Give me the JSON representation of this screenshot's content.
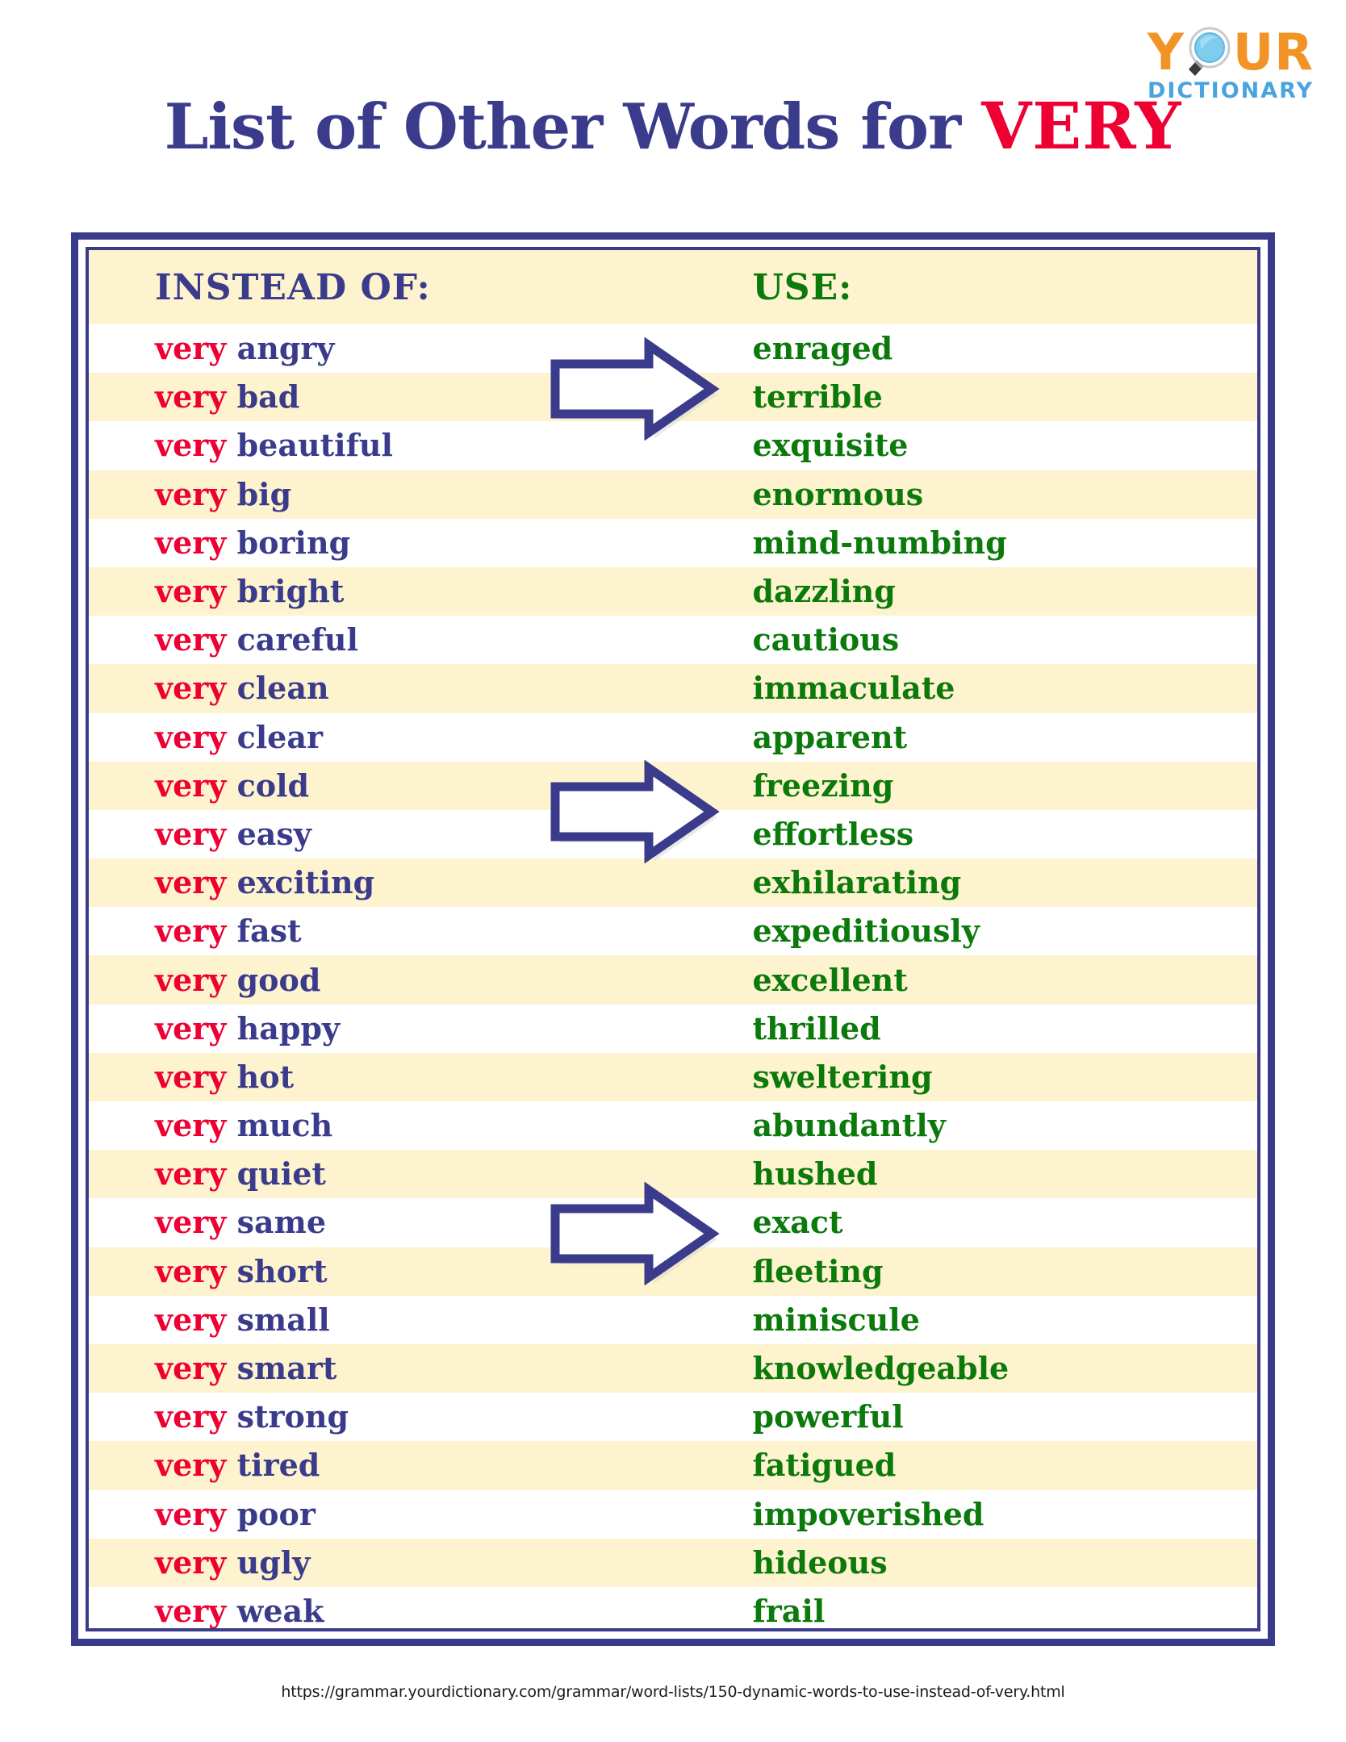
{
  "logo": {
    "wordmark_pre": "Y",
    "wordmark_post": "UR",
    "subtitle": "DICTIONARY",
    "magnifier_icon": "magnifying-glass-icon",
    "orange": "#F29325",
    "blue": "#4BA3DE"
  },
  "title": {
    "main": "List of Other Words for ",
    "accent": "VERY"
  },
  "table": {
    "headers": {
      "left": "INSTEAD OF:",
      "right": "USE:"
    },
    "very_label": "very",
    "rows": [
      {
        "adj": "angry",
        "alt": "enraged"
      },
      {
        "adj": "bad",
        "alt": "terrible"
      },
      {
        "adj": "beautiful",
        "alt": "exquisite"
      },
      {
        "adj": "big",
        "alt": "enormous"
      },
      {
        "adj": "boring",
        "alt": "mind-numbing"
      },
      {
        "adj": "bright",
        "alt": "dazzling"
      },
      {
        "adj": "careful",
        "alt": "cautious"
      },
      {
        "adj": "clean",
        "alt": "immaculate"
      },
      {
        "adj": "clear",
        "alt": "apparent"
      },
      {
        "adj": "cold",
        "alt": "freezing"
      },
      {
        "adj": "easy",
        "alt": "effortless"
      },
      {
        "adj": "exciting",
        "alt": "exhilarating"
      },
      {
        "adj": "fast",
        "alt": "expeditiously"
      },
      {
        "adj": "good",
        "alt": "excellent"
      },
      {
        "adj": "happy",
        "alt": "thrilled"
      },
      {
        "adj": "hot",
        "alt": "sweltering"
      },
      {
        "adj": "much",
        "alt": "abundantly"
      },
      {
        "adj": "quiet",
        "alt": "hushed"
      },
      {
        "adj": "same",
        "alt": "exact"
      },
      {
        "adj": "short",
        "alt": "fleeting"
      },
      {
        "adj": "small",
        "alt": "miniscule"
      },
      {
        "adj": "smart",
        "alt": "knowledgeable"
      },
      {
        "adj": "strong",
        "alt": "powerful"
      },
      {
        "adj": "tired",
        "alt": "fatigued"
      },
      {
        "adj": "poor",
        "alt": "impoverished"
      },
      {
        "adj": "ugly",
        "alt": "hideous"
      },
      {
        "adj": "weak",
        "alt": "frail"
      }
    ]
  },
  "arrows": [
    {
      "name": "arrow-right-icon-1"
    },
    {
      "name": "arrow-right-icon-2"
    },
    {
      "name": "arrow-right-icon-3"
    }
  ],
  "footer": {
    "url": "https://grammar.yourdictionary.com/grammar/word-lists/150-dynamic-words-to-use-instead-of-very.html"
  },
  "colors": {
    "navy": "#3B3B8C",
    "red": "#EE0033",
    "green": "#0B7A0B",
    "cream": "#FDF3CE",
    "white": "#FFFFFF"
  }
}
